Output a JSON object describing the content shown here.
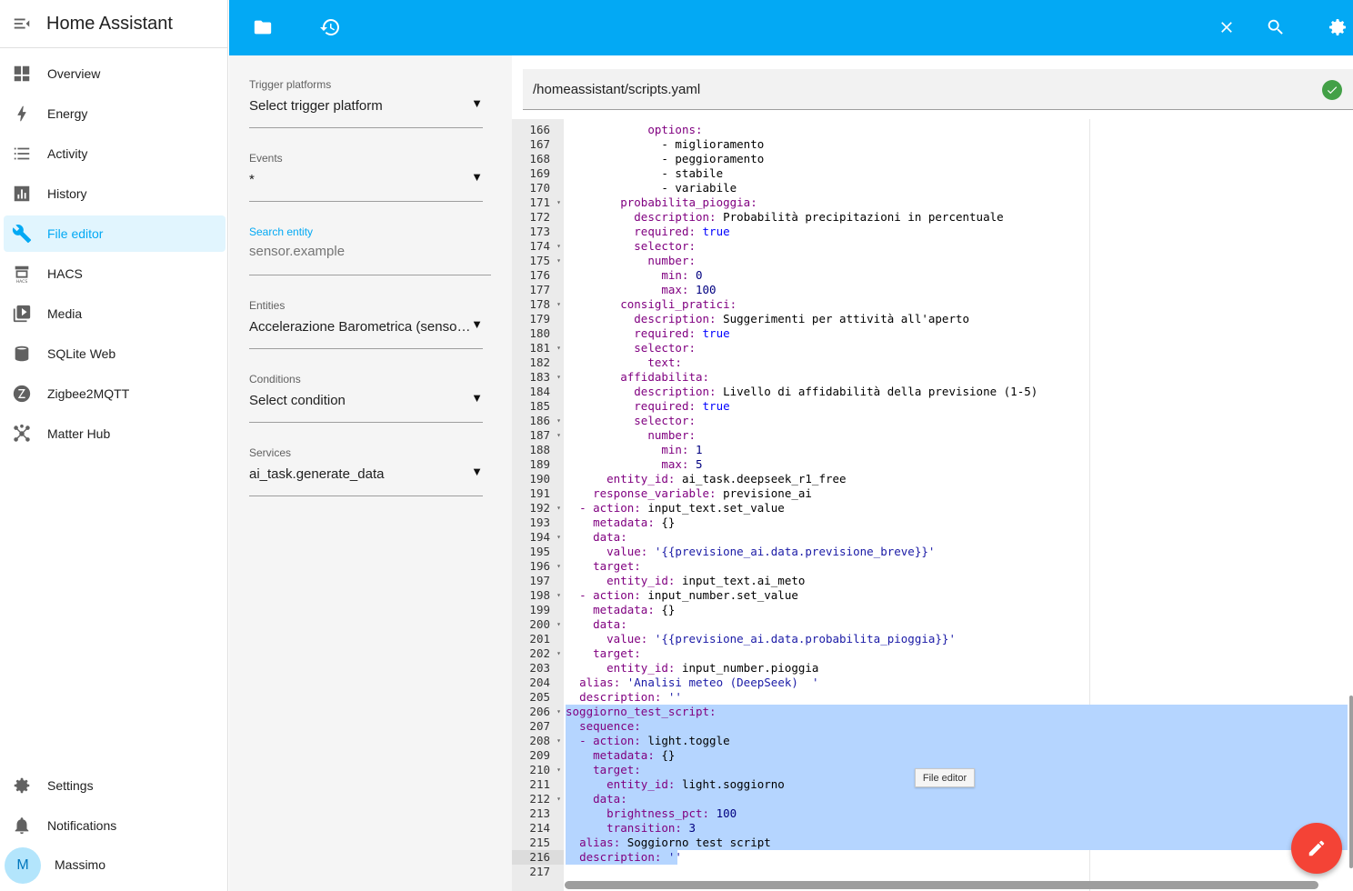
{
  "app": {
    "title": "Home Assistant"
  },
  "sidebar": {
    "items": [
      {
        "label": "Overview",
        "icon": "overview-icon"
      },
      {
        "label": "Energy",
        "icon": "lightning-icon"
      },
      {
        "label": "Activity",
        "icon": "list-icon"
      },
      {
        "label": "History",
        "icon": "chart-icon"
      },
      {
        "label": "File editor",
        "icon": "wrench-icon",
        "active": true
      },
      {
        "label": "HACS",
        "icon": "hacs-icon"
      },
      {
        "label": "Media",
        "icon": "media-icon"
      },
      {
        "label": "SQLite Web",
        "icon": "database-icon"
      },
      {
        "label": "Zigbee2MQTT",
        "icon": "zigbee-icon"
      },
      {
        "label": "Matter Hub",
        "icon": "hub-icon"
      }
    ],
    "settings_label": "Settings",
    "notifications_label": "Notifications",
    "user": {
      "initial": "M",
      "name": "Massimo"
    }
  },
  "panel": {
    "trigger": {
      "label": "Trigger platforms",
      "value": "Select trigger platform"
    },
    "events": {
      "label": "Events",
      "value": "*"
    },
    "search": {
      "label": "Search entity",
      "placeholder": "sensor.example"
    },
    "entities": {
      "label": "Entities",
      "value": "Accelerazione Barometrica (sensor.accelerazione_barometrica)"
    },
    "conditions": {
      "label": "Conditions",
      "value": "Select condition"
    },
    "services": {
      "label": "Services",
      "value": "ai_task.generate_data"
    }
  },
  "editor": {
    "path": "/homeassistant/scripts.yaml",
    "tooltip": "File editor",
    "current_line": 216,
    "lines": [
      {
        "n": "166",
        "f": false,
        "t": "            <span class=\"k\">options:</span>"
      },
      {
        "n": "167",
        "f": false,
        "t": "              - miglioramento"
      },
      {
        "n": "168",
        "f": false,
        "t": "              - peggioramento"
      },
      {
        "n": "169",
        "f": false,
        "t": "              - stabile"
      },
      {
        "n": "170",
        "f": false,
        "t": "              - variabile"
      },
      {
        "n": "171",
        "f": true,
        "t": "        <span class=\"k\">probabilita_pioggia:</span>"
      },
      {
        "n": "172",
        "f": false,
        "t": "          <span class=\"k\">description:</span> Probabilità precipitazioni in percentuale"
      },
      {
        "n": "173",
        "f": false,
        "t": "          <span class=\"k\">required:</span> <span class=\"b\">true</span>"
      },
      {
        "n": "174",
        "f": true,
        "t": "          <span class=\"k\">selector:</span>"
      },
      {
        "n": "175",
        "f": true,
        "t": "            <span class=\"k\">number:</span>"
      },
      {
        "n": "176",
        "f": false,
        "t": "              <span class=\"k\">min:</span> <span class=\"n\">0</span>"
      },
      {
        "n": "177",
        "f": false,
        "t": "              <span class=\"k\">max:</span> <span class=\"n\">100</span>"
      },
      {
        "n": "178",
        "f": true,
        "t": "        <span class=\"k\">consigli_pratici:</span>"
      },
      {
        "n": "179",
        "f": false,
        "t": "          <span class=\"k\">description:</span> Suggerimenti per attività all'aperto"
      },
      {
        "n": "180",
        "f": false,
        "t": "          <span class=\"k\">required:</span> <span class=\"b\">true</span>"
      },
      {
        "n": "181",
        "f": true,
        "t": "          <span class=\"k\">selector:</span>"
      },
      {
        "n": "182",
        "f": false,
        "t": "            <span class=\"k\">text:</span>"
      },
      {
        "n": "183",
        "f": true,
        "t": "        <span class=\"k\">affidabilita:</span>"
      },
      {
        "n": "184",
        "f": false,
        "t": "          <span class=\"k\">description:</span> Livello di affidabilità della previsione (1-5)"
      },
      {
        "n": "185",
        "f": false,
        "t": "          <span class=\"k\">required:</span> <span class=\"b\">true</span>"
      },
      {
        "n": "186",
        "f": true,
        "t": "          <span class=\"k\">selector:</span>"
      },
      {
        "n": "187",
        "f": true,
        "t": "            <span class=\"k\">number:</span>"
      },
      {
        "n": "188",
        "f": false,
        "t": "              <span class=\"k\">min:</span> <span class=\"n\">1</span>"
      },
      {
        "n": "189",
        "f": false,
        "t": "              <span class=\"k\">max:</span> <span class=\"n\">5</span>"
      },
      {
        "n": "190",
        "f": false,
        "t": "      <span class=\"k\">entity_id:</span> ai_task.deepseek_r1_free"
      },
      {
        "n": "191",
        "f": false,
        "t": "    <span class=\"k\">response_variable:</span> previsione_ai"
      },
      {
        "n": "192",
        "f": true,
        "t": "  <span class=\"k\">- action:</span> input_text.set_value"
      },
      {
        "n": "193",
        "f": false,
        "t": "    <span class=\"k\">metadata:</span> {}"
      },
      {
        "n": "194",
        "f": true,
        "t": "    <span class=\"k\">data:</span>"
      },
      {
        "n": "195",
        "f": false,
        "t": "      <span class=\"k\">value:</span> <span class=\"s\">'{{previsione_ai.data.previsione_breve}}'</span>"
      },
      {
        "n": "196",
        "f": true,
        "t": "    <span class=\"k\">target:</span>"
      },
      {
        "n": "197",
        "f": false,
        "t": "      <span class=\"k\">entity_id:</span> input_text.ai_meto"
      },
      {
        "n": "198",
        "f": true,
        "t": "  <span class=\"k\">- action:</span> input_number.set_value"
      },
      {
        "n": "199",
        "f": false,
        "t": "    <span class=\"k\">metadata:</span> {}"
      },
      {
        "n": "200",
        "f": true,
        "t": "    <span class=\"k\">data:</span>"
      },
      {
        "n": "201",
        "f": false,
        "t": "      <span class=\"k\">value:</span> <span class=\"s\">'{{previsione_ai.data.probabilita_pioggia}}'</span>"
      },
      {
        "n": "202",
        "f": true,
        "t": "    <span class=\"k\">target:</span>"
      },
      {
        "n": "203",
        "f": false,
        "t": "      <span class=\"k\">entity_id:</span> input_number.pioggia"
      },
      {
        "n": "204",
        "f": false,
        "t": "  <span class=\"k\">alias:</span> <span class=\"s\">'Analisi meteo (DeepSeek)  '</span>"
      },
      {
        "n": "205",
        "f": false,
        "t": "  <span class=\"k\">description:</span> <span class=\"s\">''</span>"
      },
      {
        "n": "206",
        "f": true,
        "t": "<span class=\"k\">soggiorno_test_script:</span>"
      },
      {
        "n": "207",
        "f": false,
        "t": "  <span class=\"k\">sequence:</span>"
      },
      {
        "n": "208",
        "f": true,
        "t": "  <span class=\"k\">- action:</span> light.toggle"
      },
      {
        "n": "209",
        "f": false,
        "t": "    <span class=\"k\">metadata:</span> {}"
      },
      {
        "n": "210",
        "f": true,
        "t": "    <span class=\"k\">target:</span>"
      },
      {
        "n": "211",
        "f": false,
        "t": "      <span class=\"k\">entity_id:</span> light.soggiorno"
      },
      {
        "n": "212",
        "f": true,
        "t": "    <span class=\"k\">data:</span>"
      },
      {
        "n": "213",
        "f": false,
        "t": "      <span class=\"k\">brightness_pct:</span> <span class=\"n\">100</span>"
      },
      {
        "n": "214",
        "f": false,
        "t": "      <span class=\"k\">transition:</span> <span class=\"n\">3</span>"
      },
      {
        "n": "215",
        "f": false,
        "t": "  <span class=\"k\">alias:</span> Soggiorno test script"
      },
      {
        "n": "216",
        "f": false,
        "t": "  <span class=\"k\">description:</span> <span class=\"s\">''</span>"
      },
      {
        "n": "217",
        "f": false,
        "t": ""
      }
    ]
  }
}
